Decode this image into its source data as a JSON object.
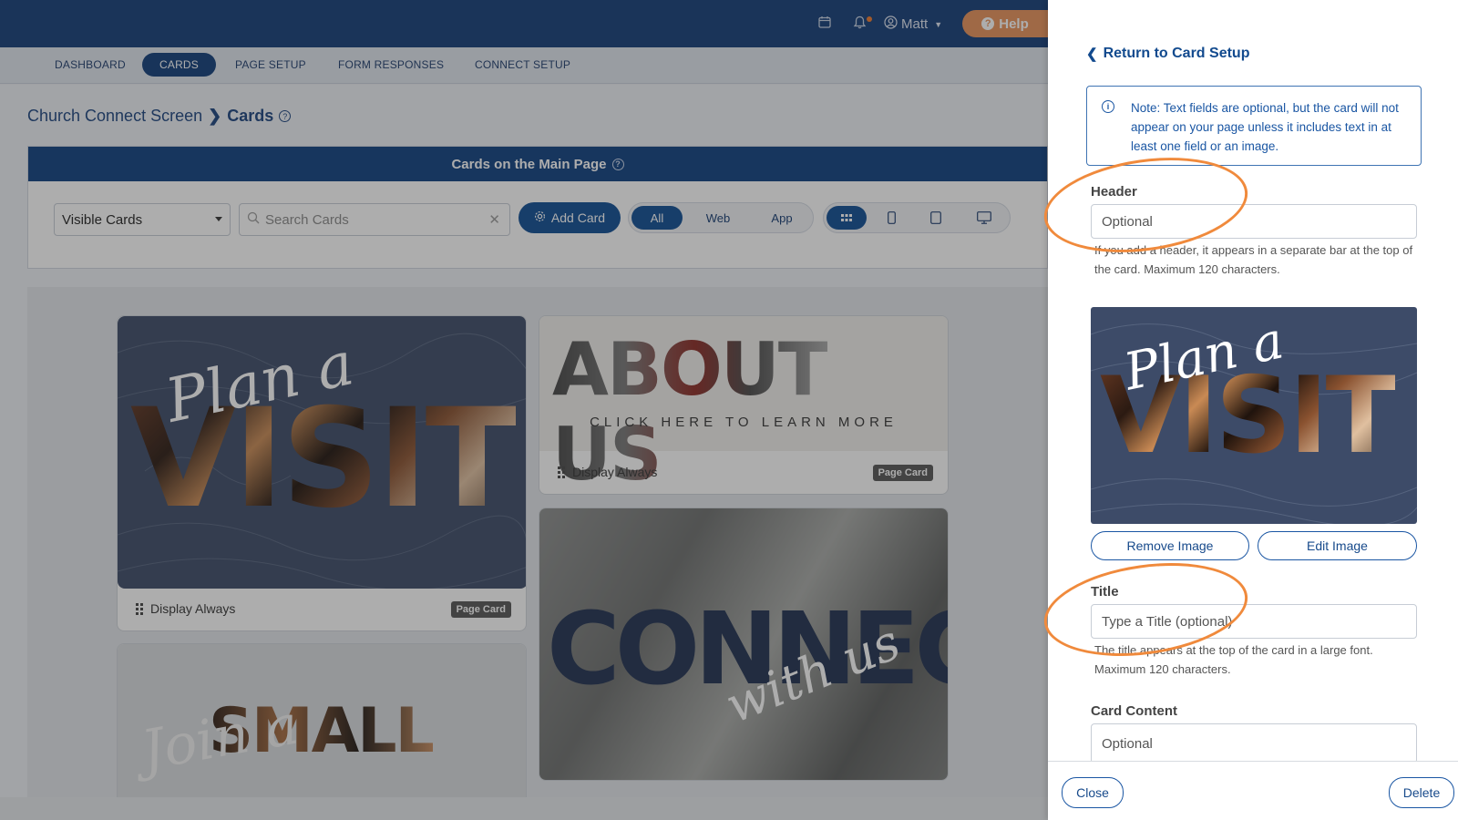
{
  "topbar": {
    "user_name": "Matt",
    "help_label": "Help"
  },
  "nav": {
    "tabs": [
      "DASHBOARD",
      "CARDS",
      "PAGE SETUP",
      "FORM RESPONSES",
      "CONNECT SETUP"
    ],
    "active": "CARDS"
  },
  "breadcrumb": {
    "parent": "Church Connect Screen",
    "current": "Cards"
  },
  "cards_panel": {
    "title": "Cards on the Main Page",
    "visibility_select": "Visible Cards",
    "search_placeholder": "Search Cards",
    "add_card_label": "Add Card",
    "filters": [
      "All",
      "Web",
      "App"
    ],
    "active_filter": "All"
  },
  "cards": [
    {
      "art_script": "Plan a",
      "art_word": "VISIT",
      "display": "Display Always",
      "badge": "Page Card"
    },
    {
      "art_word": "ABOUT US",
      "art_sub": "CLICK HERE TO LEARN MORE",
      "display": "Display Always",
      "badge": "Page Card"
    },
    {
      "art_script": "Join a",
      "art_word": "SMALL"
    },
    {
      "art_script": "with us",
      "art_word": "CONNECT"
    }
  ],
  "drawer": {
    "return_label": "Return to Card Setup",
    "note": "Note: Text fields are optional, but the card will not appear on your page unless it includes text in at least one field or an image.",
    "header_label": "Header",
    "header_placeholder": "Optional",
    "header_help": "If you add a header, it appears in a separate bar at the top of the card. Maximum 120 characters.",
    "preview_script": "Plan a",
    "preview_word": "VISIT",
    "remove_image_label": "Remove Image",
    "edit_image_label": "Edit Image",
    "title_label": "Title",
    "title_placeholder": "Type a Title (optional)",
    "title_help": "The title appears at the top of the card in a large font. Maximum 120 characters.",
    "content_label": "Card Content",
    "content_placeholder": "Optional",
    "close_label": "Close",
    "delete_label": "Delete"
  },
  "colors": {
    "brand_navy": "#123c78",
    "accent_orange": "#f08a3c",
    "link_blue": "#124a8e"
  }
}
